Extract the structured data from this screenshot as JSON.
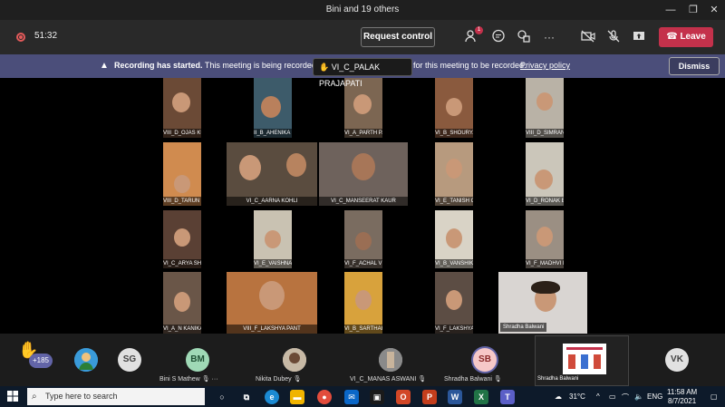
{
  "window": {
    "title": "Bini and 19 others"
  },
  "toolbar": {
    "timer": "51:32",
    "request_control": "Request control",
    "participants_badge": "1",
    "leave": "Leave"
  },
  "banner": {
    "title": "Recording has started.",
    "text": "This meeting is being recorded. By j",
    "after": "for this meeting to be recorded.",
    "link": "Privacy policy",
    "dismiss": "Dismiss",
    "tooltip": "VI_C_PALAK PRAJAPATI"
  },
  "tiles": [
    "VIII_D_OJAS KULSHRESTHA",
    "II_B_AHENIKA MUKHOPADHI...",
    "VI_A_PARTH PARASHAR",
    "VI_B_SHOURYA SHUKLA",
    "VIII_D_SIMRANJEET KAUR",
    "VIII_D_TARUN S",
    "VI_C_AARNA KOHLI",
    "VI_C_MANSEERAT KAUR",
    "VI_E_TANISH CHOUDHARY",
    "VI_D_RONAK BIRLA",
    "VI_C_ARYA SHARMA",
    "VI_E_VAISHNAVI GUPTA",
    "VI_F_ACHAL VISHWAKARMA",
    "VI_B_VANSHIKA SONI",
    "VI_F_MADHVI KUSHWAHA",
    "VI_A_N KANIKA RAJ",
    "VIII_F_LAKSHYA PANT",
    "VI_B_SARTHAK GUPTA",
    "VI_F_LAKSHYA SHARMA",
    "Shradha Balwani"
  ],
  "bottom": {
    "raised_count": "+185",
    "avatars": [
      {
        "initials": "SG",
        "name": ""
      },
      {
        "initials": "BM",
        "name": "Bini S Mathew"
      },
      {
        "initials": "",
        "name": "Nikita Dubey"
      },
      {
        "initials": "",
        "name": "VI_C_MANAS ASWANI"
      },
      {
        "initials": "SB",
        "name": "Shradha Balwani"
      },
      {
        "initials": "VK",
        "name": ""
      }
    ],
    "more": "···",
    "selfview_name": "Shradha Balwani"
  },
  "taskbar": {
    "search_placeholder": "Type here to search",
    "weather": "31°C",
    "lang": "ENG",
    "time": "11:58 AM",
    "date": "8/7/2021"
  },
  "colors": {
    "accent": "#6264a7",
    "leave": "#c4314b",
    "banner": "#4b4e7a"
  }
}
